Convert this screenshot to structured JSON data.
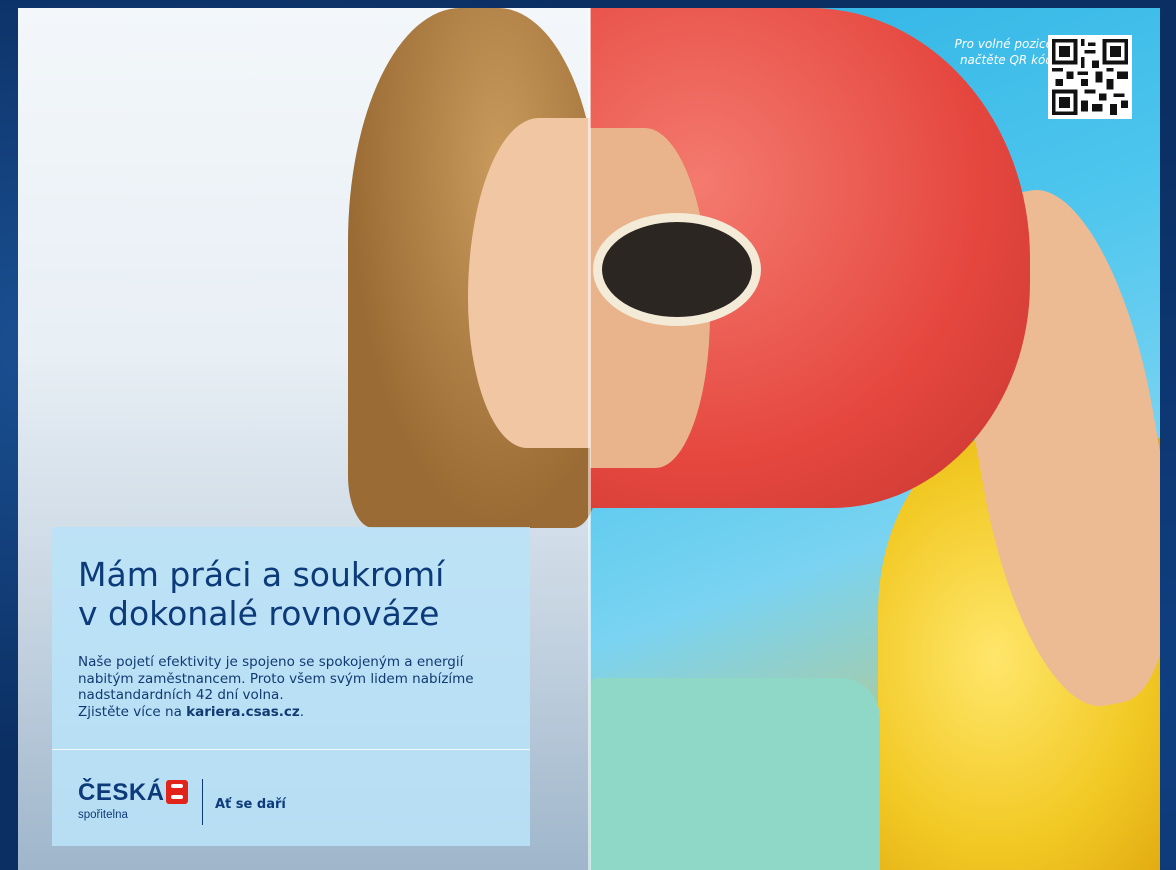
{
  "qr": {
    "caption": "Pro volné pozice načtěte QR kód",
    "icon": "qr-code-icon"
  },
  "card": {
    "headline_line1": "Mám práci a soukromí",
    "headline_line2": "v dokonalé rovnováze",
    "body_line1": "Naše pojetí efektivity je spojeno se spokojeným a energií",
    "body_line2": "nabitým zaměstnancem. Proto všem svým lidem nabízíme",
    "body_line3": "nadstandardních 42 dní volna.",
    "body_line4_prefix": "Zjistěte více na ",
    "body_link": "kariera.csas.cz",
    "body_line4_suffix": "."
  },
  "brand": {
    "name": "ČESKÁ",
    "sub": "spořitelna",
    "slogan": "Ať se daří",
    "accent": "#e2231a",
    "primary": "#0d3b7a"
  }
}
